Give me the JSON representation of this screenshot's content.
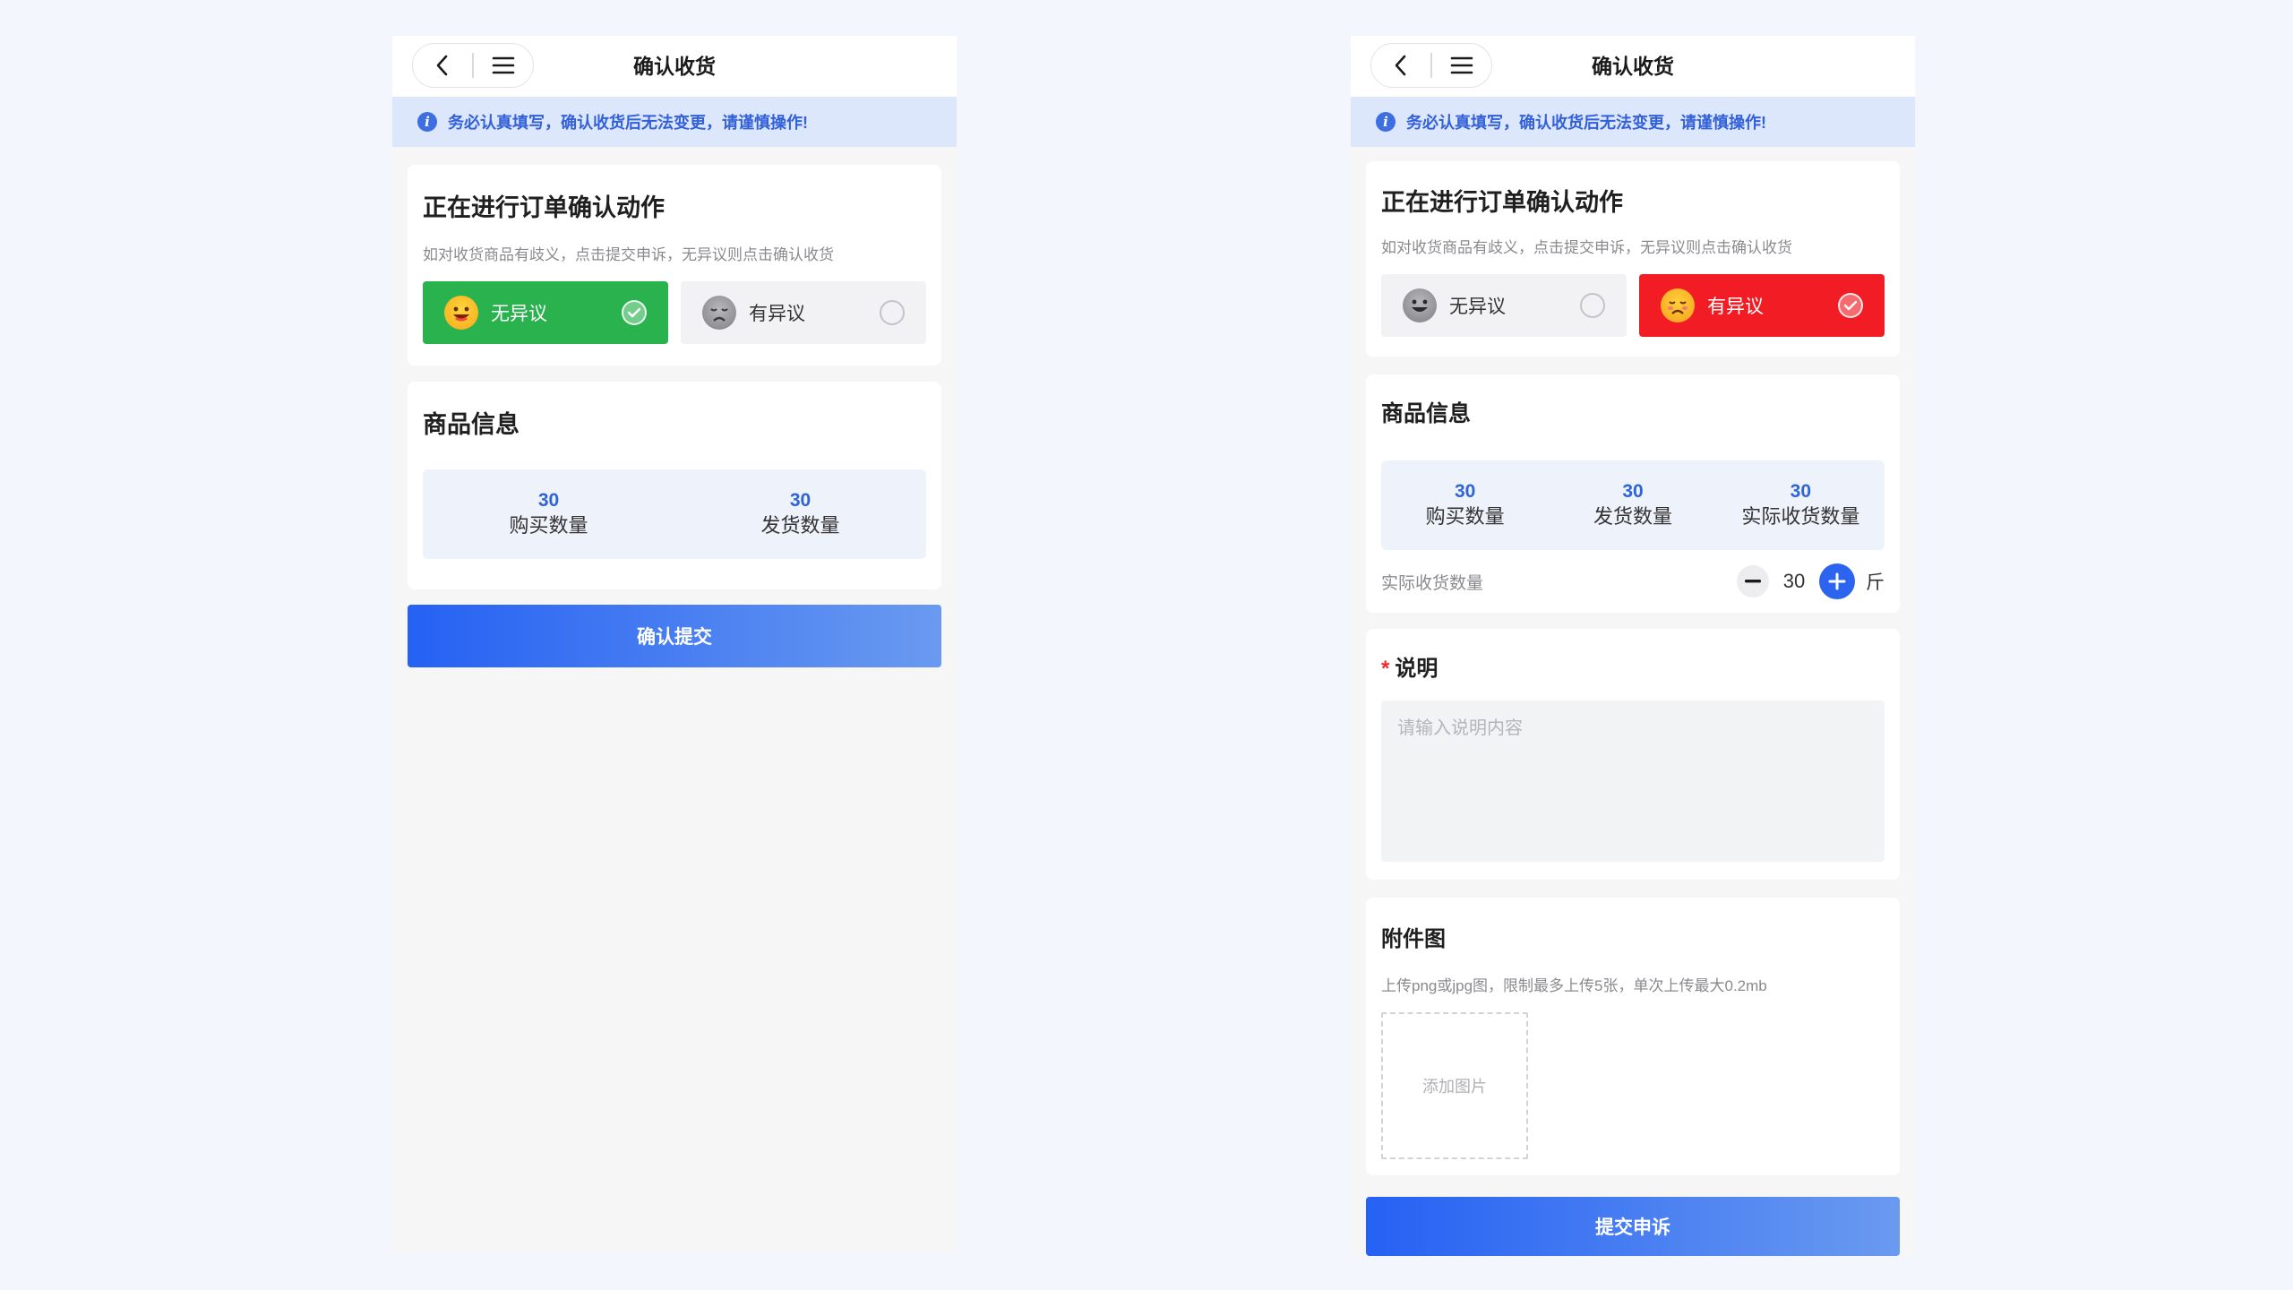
{
  "left_screen": {
    "header": {
      "title": "确认收货",
      "back_icon": "chevron-left-icon",
      "menu_icon": "menu-icon"
    },
    "notice": "务必认真填写，确认收货后无法变更，请谨慎操作!",
    "action_card": {
      "title": "正在进行订单确认动作",
      "subtitle": "如对收货商品有歧义，点击提交申诉，无异议则点击确认收货",
      "option_no_objection": "无异议",
      "option_objection": "有异议",
      "selected": "无异议"
    },
    "goods_card": {
      "title": "商品信息",
      "stats": [
        {
          "value": "30",
          "label": "购买数量"
        },
        {
          "value": "30",
          "label": "发货数量"
        }
      ]
    },
    "submit_label": "确认提交",
    "accent_color": "#2ab24f"
  },
  "right_screen": {
    "header": {
      "title": "确认收货",
      "back_icon": "chevron-left-icon",
      "menu_icon": "menu-icon"
    },
    "notice": "务必认真填写，确认收货后无法变更，请谨慎操作!",
    "action_card": {
      "title": "正在进行订单确认动作",
      "subtitle": "如对收货商品有歧义，点击提交申诉，无异议则点击确认收货",
      "option_no_objection": "无异议",
      "option_objection": "有异议",
      "selected": "有异议"
    },
    "goods_card": {
      "title": "商品信息",
      "stats": [
        {
          "value": "30",
          "label": "购买数量"
        },
        {
          "value": "30",
          "label": "发货数量"
        },
        {
          "value": "30",
          "label": "实际收货数量"
        }
      ],
      "actual_qty_label": "实际收货数量",
      "actual_qty_value": "30",
      "unit": "斤"
    },
    "description": {
      "required_mark": "*",
      "title": "说明",
      "placeholder": "请输入说明内容",
      "value": ""
    },
    "attachment": {
      "title": "附件图",
      "hint": "上传png或jpg图，限制最多上传5张，单次上传最大0.2mb",
      "add_label": "添加图片"
    },
    "submit_label": "提交申诉",
    "accent_color": "#f21d24"
  },
  "primary_color": "#2561f3"
}
